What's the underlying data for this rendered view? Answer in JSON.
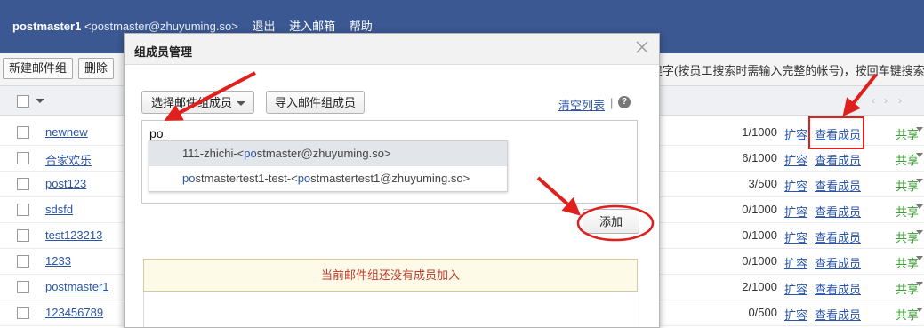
{
  "header": {
    "username": "postmaster1",
    "email": "<postmaster@zhuyuming.so>",
    "links": [
      "退出",
      "进入邮箱",
      "帮助"
    ]
  },
  "toolbar": {
    "new_group": "新建邮件组",
    "delete": "删除",
    "search_hint": "建字(按员工搜索时需输入完整的帐号)，按回车键搜索"
  },
  "table": {
    "rows": [
      {
        "name": "newnew",
        "count": "1/1000",
        "expand": "扩容",
        "view": "查看成员",
        "share": "共享"
      },
      {
        "name": "合家欢乐",
        "count": "6/1000",
        "expand": "扩容",
        "view": "查看成员",
        "share": "共享"
      },
      {
        "name": "post123",
        "count": "3/500",
        "expand": "扩容",
        "view": "查看成员",
        "share": "共享"
      },
      {
        "name": "sdsfd",
        "count": "0/1000",
        "expand": "扩容",
        "view": "查看成员",
        "share": "共享"
      },
      {
        "name": "test123213",
        "count": "0/1000",
        "expand": "扩容",
        "view": "查看成员",
        "share": "共享"
      },
      {
        "name": "1233",
        "count": "0/1000",
        "expand": "扩容",
        "view": "查看成员",
        "share": "共享"
      },
      {
        "name": "postmaster1",
        "count": "2/1000",
        "expand": "扩容",
        "view": "查看成员",
        "share": "共享"
      },
      {
        "name": "123456789",
        "count": "0/500",
        "expand": "扩容",
        "view": "查看成员",
        "share": "共享"
      }
    ]
  },
  "modal": {
    "title": "组成员管理",
    "select_members": "选择邮件组成员",
    "import_members": "导入邮件组成员",
    "clear_list": "清空列表",
    "separator": "|",
    "help": "?",
    "typed_value": "po",
    "suggestions": [
      {
        "match": "",
        "text": "111-zhichi-<",
        "match2": "po",
        "rest": "stmaster@zhuyuming.so>"
      },
      {
        "match": "po",
        "text": "stmastertest1-test-<",
        "match2": "po",
        "rest": "stmastertest1@zhuyuming.so>"
      }
    ],
    "add_button": "添加",
    "empty_message": "当前邮件组还没有成员加入"
  },
  "colors": {
    "header_bg": "#3b5892",
    "link": "#2b55a6",
    "share": "#37a02f",
    "annotation": "#e0201c",
    "empty_text": "#c0392b"
  }
}
